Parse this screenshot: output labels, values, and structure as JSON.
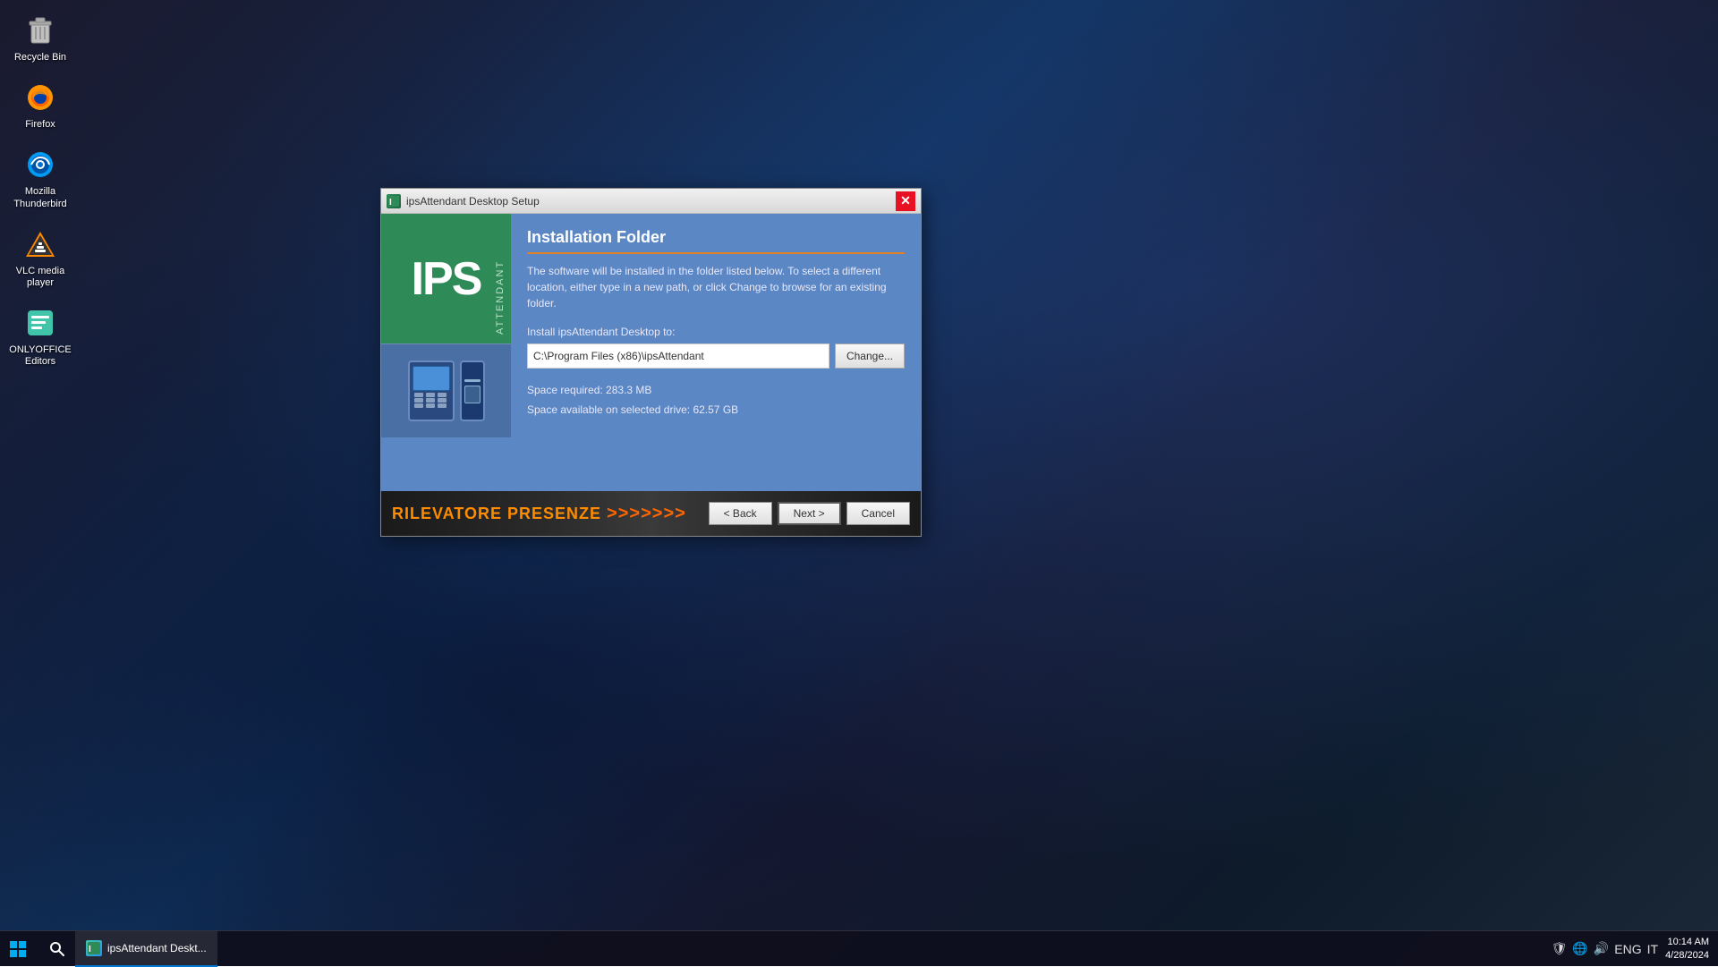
{
  "desktop": {
    "background_description": "dark blue abstract desktop background"
  },
  "desktop_icons": [
    {
      "id": "recycle-bin",
      "label": "Recycle Bin",
      "icon_type": "recycle-bin"
    },
    {
      "id": "firefox",
      "label": "Firefox",
      "icon_type": "firefox"
    },
    {
      "id": "thunderbird",
      "label": "Mozilla Thunderbird",
      "icon_type": "thunderbird"
    },
    {
      "id": "vlc",
      "label": "VLC media player",
      "icon_type": "vlc"
    },
    {
      "id": "onlyoffice",
      "label": "ONLYOFFICE Editors",
      "icon_type": "onlyoffice"
    }
  ],
  "dialog": {
    "title": "ipsAttendant Desktop Setup",
    "section_title": "Installation Folder",
    "description": "The software will be installed in the folder listed below. To select a different location, either type in a new path, or click Change to browse for an existing folder.",
    "install_label": "Install ipsAttendant Desktop to:",
    "install_path": "C:\\Program Files (x86)\\ipsAttendant",
    "change_button": "Change...",
    "space_required_label": "Space required: 283.3 MB",
    "space_available_label": "Space available on selected drive: 62.57 GB",
    "footer_brand": "RILEVATORE PRESENZE",
    "back_button": "< Back",
    "next_button": "Next >",
    "cancel_button": "Cancel"
  },
  "taskbar": {
    "app_label": "ipsAttendant Deskt...",
    "time": "10:14 AM",
    "date": "4/28/2024",
    "language": "ENG",
    "keyboard": "IT"
  }
}
